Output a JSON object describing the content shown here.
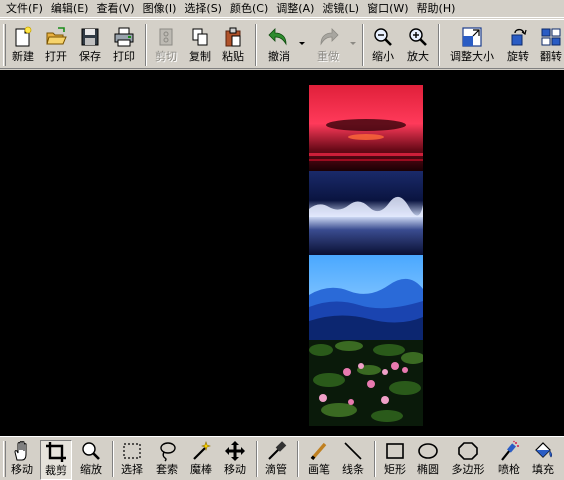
{
  "menubar": {
    "items": [
      {
        "label": "文件(F)"
      },
      {
        "label": "编辑(E)"
      },
      {
        "label": "查看(V)"
      },
      {
        "label": "图像(I)"
      },
      {
        "label": "选择(S)"
      },
      {
        "label": "颜色(C)"
      },
      {
        "label": "调整(A)"
      },
      {
        "label": "滤镜(L)"
      },
      {
        "label": "窗口(W)"
      },
      {
        "label": "帮助(H)"
      }
    ]
  },
  "toolbar": {
    "new_label": "新建",
    "open_label": "打开",
    "save_label": "保存",
    "print_label": "打印",
    "cut_label": "剪切",
    "copy_label": "复制",
    "paste_label": "粘贴",
    "undo_label": "撤消",
    "redo_label": "重做",
    "zoom_out_label": "缩小",
    "zoom_in_label": "放大",
    "resize_label": "调整大小",
    "rotate_label": "旋转",
    "flip_label": "翻转"
  },
  "tools": {
    "move_label": "移动",
    "crop_label": "裁剪",
    "zoom_label": "缩放",
    "select_label": "选择",
    "lasso_label": "套索",
    "magic_wand_label": "魔棒",
    "move_selection_label": "移动",
    "eyedropper_label": "滴管",
    "pencil_label": "画笔",
    "line_label": "线条",
    "rectangle_label": "矩形",
    "ellipse_label": "椭圆",
    "polygon_label": "多边形",
    "airbrush_label": "喷枪",
    "fill_label": "填充"
  },
  "colors": {
    "canvas_bg": "#000000",
    "ui_face": "#d4d0c8"
  }
}
